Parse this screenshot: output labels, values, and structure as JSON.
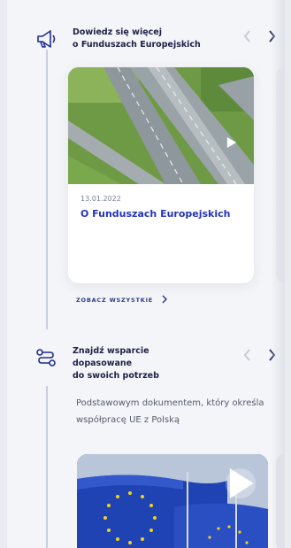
{
  "section1": {
    "title": "Dowiedz się więcej\no Funduszach Europejskich",
    "icon": "megaphone-icon",
    "prev_icon": "chevron-left-icon",
    "next_icon": "chevron-right-icon"
  },
  "article_card": {
    "date": "13.01.2022",
    "title": "O Funduszach Europejskich",
    "image": "highway-aerial-photo",
    "play_icon": "play-icon"
  },
  "see_all": {
    "label": "ZOBACZ WSZYSTKIE",
    "icon": "chevron-right-icon"
  },
  "section2": {
    "title": "Znajdź wsparcie\ndopasowane\ndo swoich potrzeb",
    "icon": "route-icon",
    "description": "Podstawowym dokumentem, który określa współpracę UE z Polską"
  },
  "video_card": {
    "image": "eu-flags-photo",
    "play_icon": "play-icon"
  },
  "colors": {
    "accent": "#2434b8",
    "heading": "#1d2145",
    "background": "#f4f5f8",
    "timeline": "#c9cedb"
  }
}
